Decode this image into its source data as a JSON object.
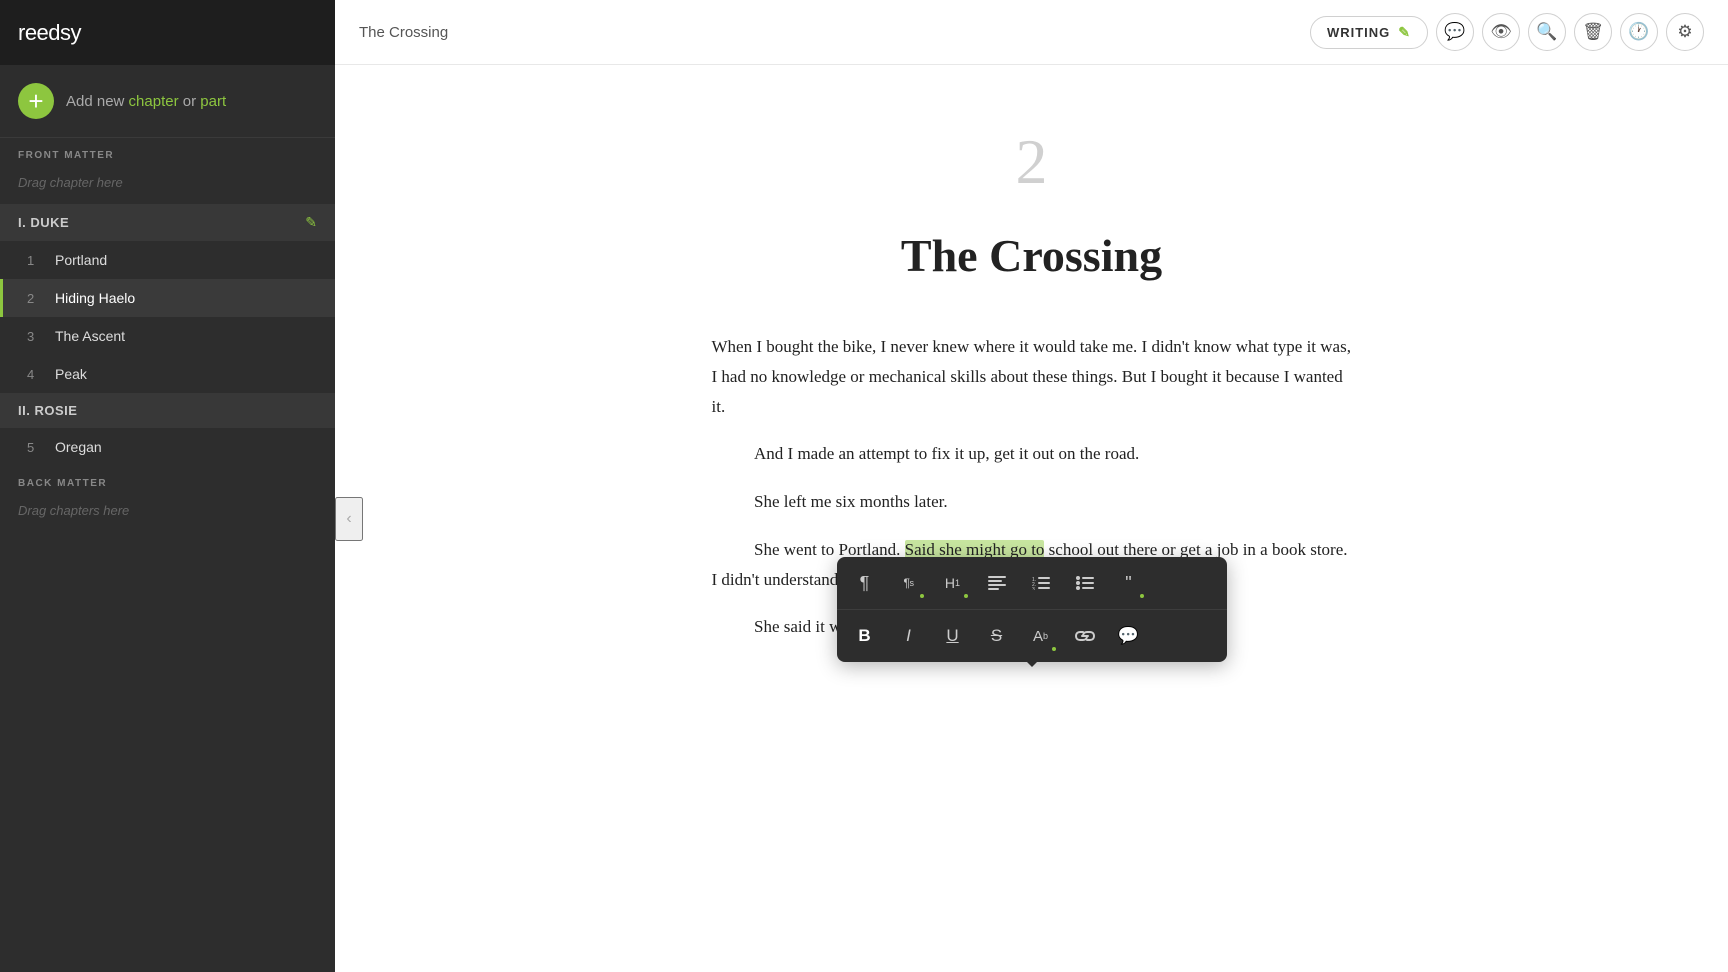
{
  "app": {
    "logo": "reedsy"
  },
  "sidebar": {
    "add_new_prefix": "Add new ",
    "add_new_chapter": "chapter",
    "add_new_or": " or ",
    "add_new_part": "part",
    "sections": {
      "front_matter": "FRONT MATTER",
      "back_matter": "BACK MATTER"
    },
    "drag_chapter": "Drag chapter here",
    "drag_chapters": "Drag chapters here",
    "parts": [
      {
        "id": "duke",
        "label": "I. DUKE",
        "chapters": [
          {
            "num": "1",
            "title": "Portland",
            "active": false
          },
          {
            "num": "2",
            "title": "Hiding Haelo",
            "active": true
          },
          {
            "num": "3",
            "title": "The Ascent",
            "active": false
          },
          {
            "num": "4",
            "title": "Peak",
            "active": false
          }
        ]
      },
      {
        "id": "rosie",
        "label": "II. ROSIE",
        "chapters": [
          {
            "num": "5",
            "title": "Oregan",
            "active": false
          }
        ]
      }
    ]
  },
  "topbar": {
    "chapter_title": "The Crossing",
    "mode_label": "WRITING",
    "icons": {
      "edit": "✎",
      "comment": "💬",
      "preview": "👁",
      "search": "🔍",
      "delete": "🗑",
      "history": "🕐",
      "settings": "⚙"
    }
  },
  "document": {
    "chapter_number": "2",
    "chapter_title": "The Crossing",
    "paragraphs": [
      {
        "indented": false,
        "text": "When I bought the bike, I never knew where it would take me. I didn't know what type it was, I had no knowledge or mechanical skills about these things. But I bought it because I wanted it."
      },
      {
        "indented": true,
        "text": "And I made an attempt to fix it up, get it out on the road."
      },
      {
        "indented": true,
        "text": "She left me six months later."
      },
      {
        "indented": true,
        "text_before_highlight": "She went to Portland. ",
        "highlight": "Said she might go to",
        "text_after_highlight": " school out there or get a job in a book store. I didn't understand."
      },
      {
        "indented": true,
        "text": "She said it was her calling. Something was pulling her there. She"
      }
    ]
  },
  "toolbar": {
    "row1": [
      {
        "icon": "¶",
        "label": "paragraph",
        "has_dot": false
      },
      {
        "icon": "¶s",
        "label": "paragraph-sans",
        "has_dot": true
      },
      {
        "icon": "H₁",
        "label": "heading-1",
        "has_dot": true
      },
      {
        "icon": "≡",
        "label": "align",
        "has_dot": false
      },
      {
        "icon": "≡n",
        "label": "numbered-list",
        "has_dot": false
      },
      {
        "icon": "≡b",
        "label": "bullet-list",
        "has_dot": false
      },
      {
        "icon": "❝",
        "label": "quote",
        "has_dot": true
      }
    ],
    "row2": [
      {
        "icon": "B",
        "label": "bold",
        "style": "bold"
      },
      {
        "icon": "I",
        "label": "italic",
        "style": "italic"
      },
      {
        "icon": "U",
        "label": "underline",
        "style": "underline"
      },
      {
        "icon": "S",
        "label": "strikethrough",
        "style": "strikethrough"
      },
      {
        "icon": "Aᵇ",
        "label": "font-size",
        "style": "normal"
      },
      {
        "icon": "🔗",
        "label": "link",
        "style": "normal"
      },
      {
        "icon": "💬",
        "label": "comment-inline",
        "style": "normal"
      }
    ]
  }
}
